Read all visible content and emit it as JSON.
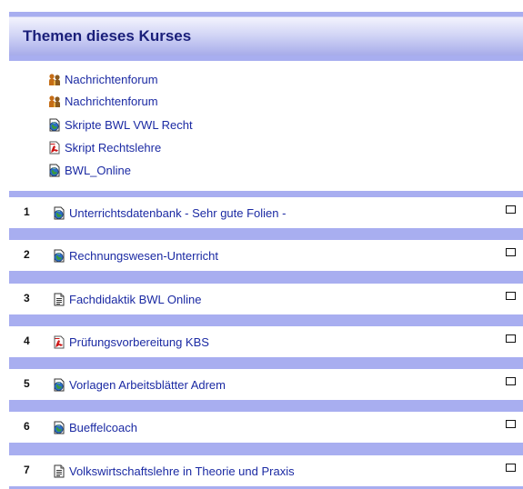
{
  "header": {
    "title": "Themen dieses Kurses"
  },
  "general": {
    "items": [
      {
        "label": "Nachrichtenforum",
        "icon": "forum-icon"
      },
      {
        "label": "Nachrichtenforum",
        "icon": "forum-icon"
      },
      {
        "label": "Skripte BWL VWL Recht",
        "icon": "web-link-icon"
      },
      {
        "label": "Skript Rechtslehre",
        "icon": "pdf-file-icon"
      },
      {
        "label": "BWL_Online",
        "icon": "web-link-icon"
      }
    ]
  },
  "topics": [
    {
      "number": "1",
      "label": "Unterrichtsdatenbank - Sehr gute Folien -",
      "icon": "web-link-icon"
    },
    {
      "number": "2",
      "label": "Rechnungswesen-Unterricht",
      "icon": "web-link-icon"
    },
    {
      "number": "3",
      "label": "Fachdidaktik BWL Online",
      "icon": "text-page-icon"
    },
    {
      "number": "4",
      "label": "Prüfungsvorbereitung KBS",
      "icon": "pdf-file-icon"
    },
    {
      "number": "5",
      "label": "Vorlagen Arbeitsblätter Adrem",
      "icon": "web-link-icon"
    },
    {
      "number": "6",
      "label": "Bueffelcoach",
      "icon": "web-link-icon"
    },
    {
      "number": "7",
      "label": "Volkswirtschaftslehre in Theorie und Praxis",
      "icon": "text-page-icon"
    }
  ],
  "colors": {
    "header_text": "#1a1f7a",
    "link": "#1b2aa3",
    "section_separator": "#a8aef0"
  }
}
